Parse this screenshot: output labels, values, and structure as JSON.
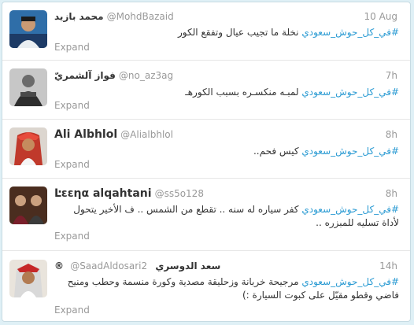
{
  "tweets": [
    {
      "name": "محمد بازيد",
      "handle": "@MohdBazaid",
      "time": "10 Aug",
      "hashtag": "#في_كل_حوش_سعودي",
      "text": "نخلة ما تجيب عيال وتفقع الكور",
      "expand": "Expand"
    },
    {
      "name": "فواز آلشمريّ",
      "handle": "@no_az3ag",
      "time": "7h",
      "hashtag": "#في_كل_حوش_سعودي",
      "text": "لمبـه منكسـره بسبب الكورهـ",
      "expand": "Expand"
    },
    {
      "name": "Ali Albhlol",
      "handle": "@Alialbhlol",
      "time": "8h",
      "hashtag": "#في_كل_حوش_سعودي",
      "text": "كيس فحم..",
      "expand": "Expand"
    },
    {
      "name": "Ŀεεηα alqahtani",
      "handle": "@ss5o128",
      "time": "8h",
      "hashtag": "#في_كل_حوش_سعودي",
      "text": "كفر سياره له سنه .. تقطع من الشمس .. ف الأخير يتحول لأداة تسليه للمبزره ..",
      "expand": "Expand"
    },
    {
      "name": "سعد الدوسري",
      "badge": "®",
      "handle": "@SaadAldosari2",
      "time": "14h",
      "hashtag": "#في_كل_حوش_سعودي",
      "text": "مرجيحة خربانة وزحليقة مصدية وكورة منسمة وحطب ومنيح فاضي وقطو مقيّل على كبوت السيارة :)",
      "expand": "Expand"
    }
  ]
}
